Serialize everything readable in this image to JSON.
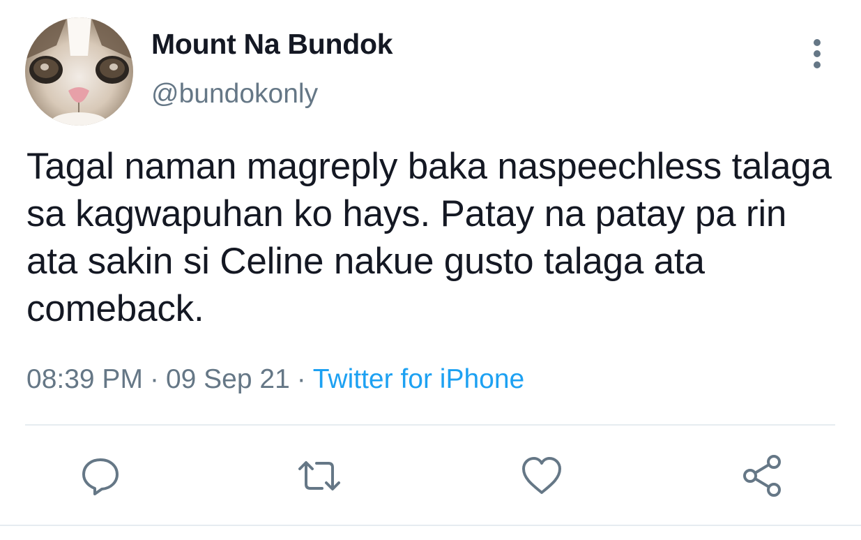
{
  "tweet": {
    "author": {
      "display_name": "Mount Na Bundok",
      "handle": "@bundokonly",
      "avatar_icon": "cat-avatar"
    },
    "text": "Tagal naman magreply baka naspeechless talaga sa kagwapuhan ko hays. Patay na patay pa rin ata sakin si Celine nakue gusto talaga ata comeback.",
    "time": "08:39 PM",
    "date": "09 Sep 21",
    "separator": "·",
    "source": "Twitter for iPhone",
    "more_icon": "more-vertical-icon"
  },
  "actions": [
    {
      "name": "reply",
      "icon": "reply-icon"
    },
    {
      "name": "retweet",
      "icon": "retweet-icon"
    },
    {
      "name": "like",
      "icon": "heart-icon"
    },
    {
      "name": "share",
      "icon": "share-icon"
    }
  ],
  "colors": {
    "text": "#141823",
    "secondary": "#657786",
    "link": "#1da1f2",
    "divider": "#e6ecf0"
  }
}
